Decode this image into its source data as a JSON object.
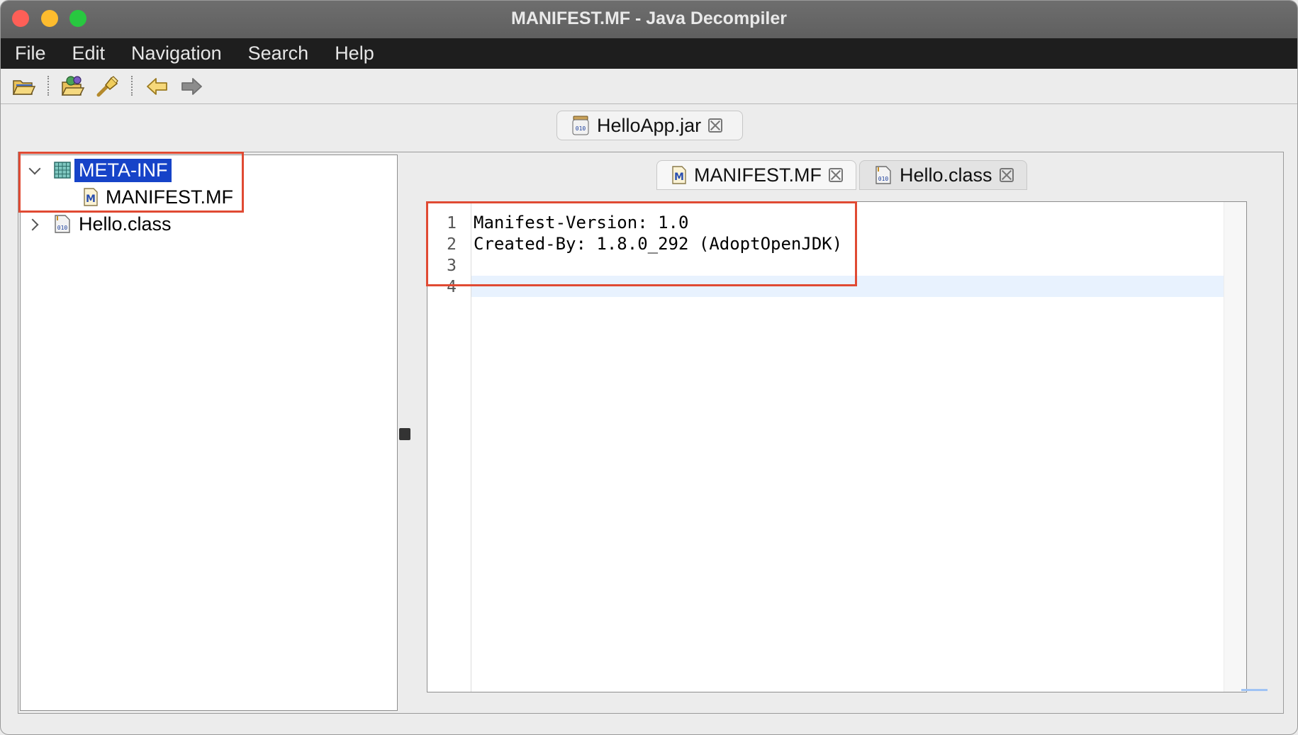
{
  "window": {
    "title": "MANIFEST.MF - Java Decompiler"
  },
  "menu": {
    "items": [
      "File",
      "Edit",
      "Navigation",
      "Search",
      "Help"
    ]
  },
  "toolbar": {
    "icons": [
      "open-file-icon",
      "open-type-icon",
      "search-icon",
      "back-arrow-icon",
      "forward-arrow-icon"
    ]
  },
  "jar_tab": {
    "label": "HelloApp.jar"
  },
  "tree": {
    "folder": "META-INF",
    "folder_child": "MANIFEST.MF",
    "class_node": "Hello.class"
  },
  "editor_tabs": [
    {
      "label": "MANIFEST.MF",
      "active": true
    },
    {
      "label": "Hello.class",
      "active": false
    }
  ],
  "editor": {
    "line_numbers": [
      "1",
      "2",
      "3",
      "4"
    ],
    "lines": [
      "Manifest-Version: 1.0",
      "Created-By: 1.8.0_292 (AdoptOpenJDK)",
      "",
      ""
    ]
  },
  "colors": {
    "selection": "#1643c8",
    "highlight_box": "#e04a33",
    "current_line": "#e8f2fe"
  }
}
